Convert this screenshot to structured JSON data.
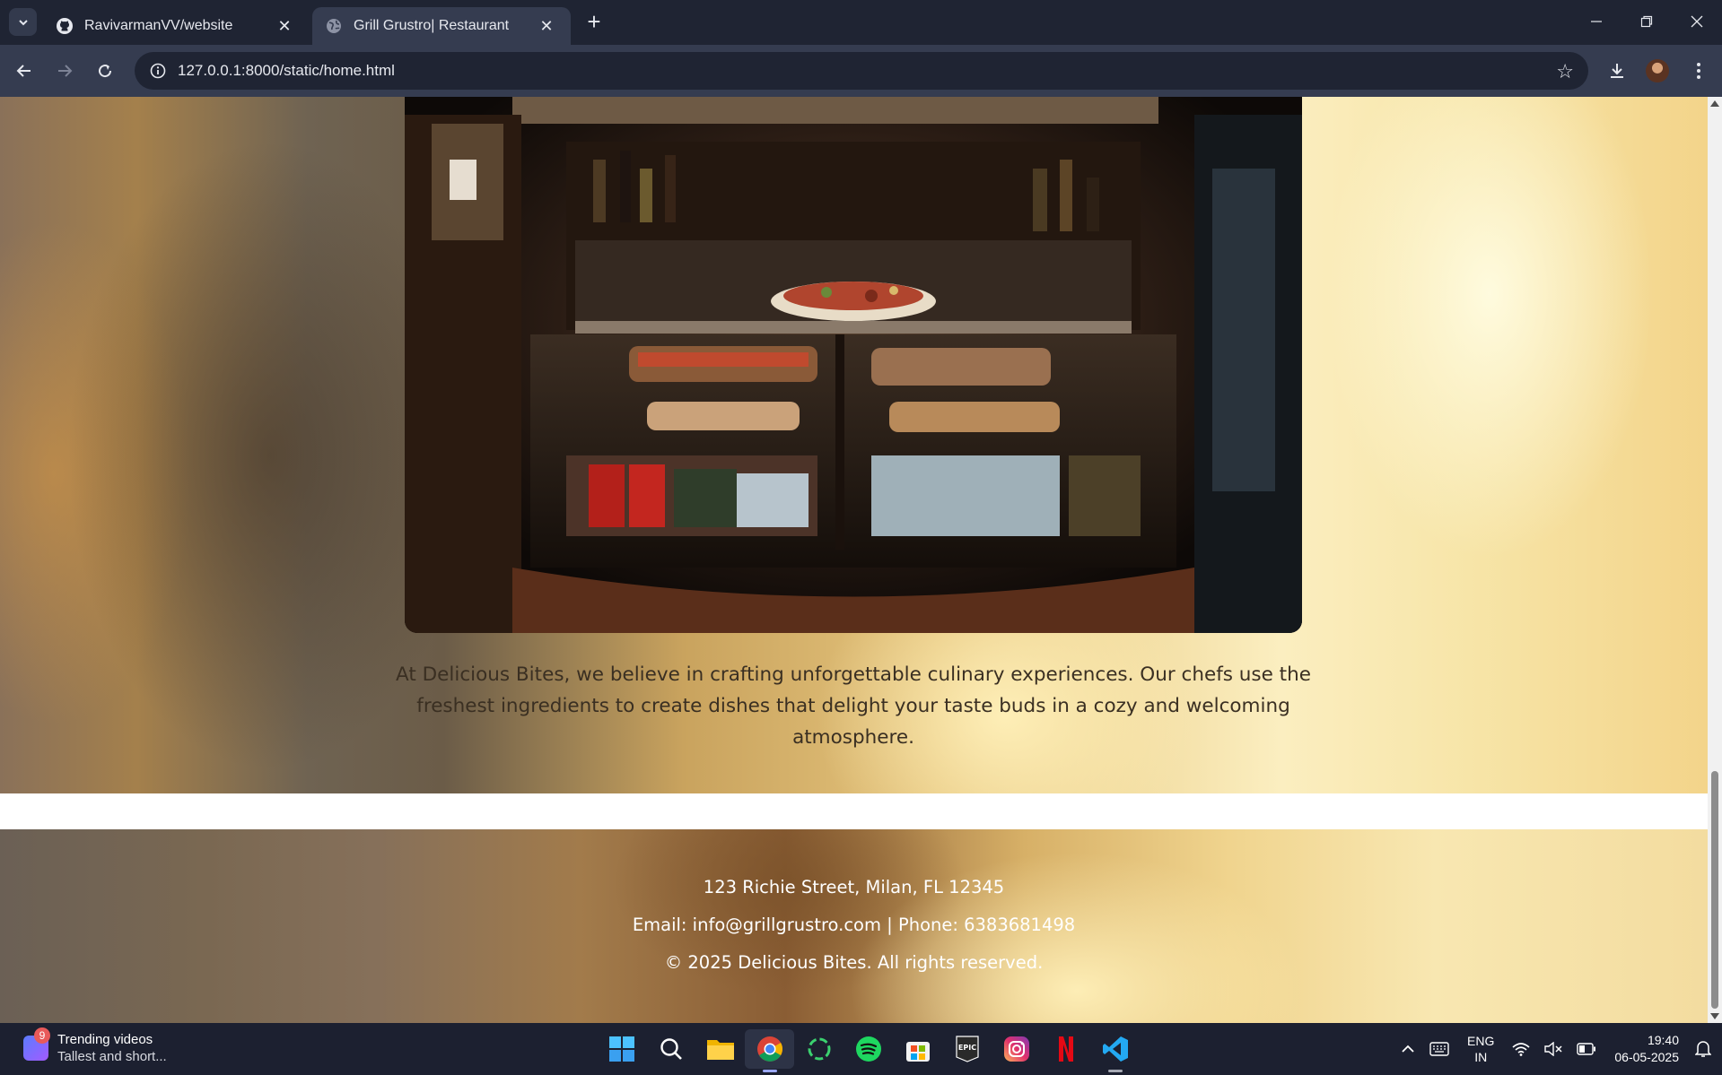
{
  "browser": {
    "tabs": [
      {
        "title": "RavivarmanVV/website",
        "icon": "github-icon",
        "active": false
      },
      {
        "title": "Grill Grustro| Restaurant",
        "icon": "globe-icon",
        "active": true
      }
    ],
    "url": "127.0.0.1:8000/static/home.html"
  },
  "page": {
    "about_text": "At Delicious Bites, we believe in crafting unforgettable culinary experiences. Our chefs use the freshest ingredients to create dishes that delight your taste buds in a cozy and welcoming atmosphere.",
    "footer": {
      "address": "123 Richie Street, Milan, FL 12345",
      "contact": "Email: info@grillgrustro.com | Phone: 6383681498",
      "copyright": "© 2025 Delicious Bites. All rights reserved."
    }
  },
  "taskbar": {
    "widget": {
      "title": "Trending videos",
      "subtitle": "Tallest and short...",
      "badge": "9"
    },
    "apps": [
      "start-icon",
      "search-icon",
      "file-explorer-icon",
      "chrome-icon",
      "green-ring-app-icon",
      "spotify-icon",
      "microsoft-store-icon",
      "epic-games-icon",
      "instagram-icon",
      "netflix-icon",
      "vscode-icon"
    ],
    "epic_label": "EPIC",
    "lang_line1": "ENG",
    "lang_line2": "IN",
    "time": "19:40",
    "date": "06-05-2025"
  },
  "colors": {
    "chrome_dark": "#1f2433",
    "chrome_toolbar": "#353c50",
    "taskbar": "#1c2030",
    "text_body": "#3a2f22"
  }
}
